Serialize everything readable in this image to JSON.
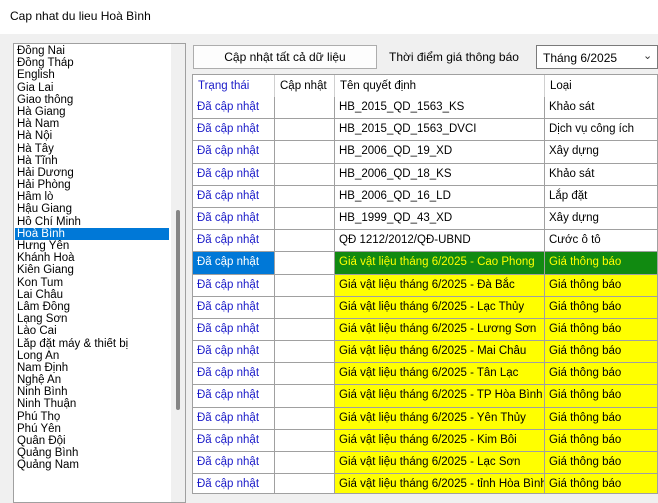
{
  "window": {
    "title": "Cap nhat du lieu Hoà Bình"
  },
  "provinces": {
    "items": [
      "Đồng Nai",
      "Đồng Tháp",
      "English",
      "Gia Lai",
      "Giao thông",
      "Hà Giang",
      "Hà Nam",
      "Hà Nội",
      "Hà Tây",
      "Hà Tĩnh",
      "Hải Dương",
      "Hải Phòng",
      "Hầm lò",
      "Hậu Giang",
      "Hồ Chí Minh",
      "Hoà Bình",
      "Hưng Yên",
      "Khánh Hoà",
      "Kiên Giang",
      "Kon Tum",
      "Lai Châu",
      "Lâm Đồng",
      "Lạng Sơn",
      "Lào Cai",
      "Lắp đặt máy & thiết bị",
      "Long An",
      "Nam Định",
      "Nghệ An",
      "Ninh Bình",
      "Ninh Thuận",
      "Phú Thọ",
      "Phú Yên",
      "Quân Đội",
      "Quảng Bình",
      "Quảng Nam"
    ],
    "selected": "Hoà Bình"
  },
  "toolbar": {
    "update_all_label": "Cập nhật tất cả dữ liệu",
    "time_label": "Thời điểm giá thông báo",
    "month_value": "Tháng 6/2025"
  },
  "grid": {
    "headers": [
      "Trạng thái",
      "Cập nhật",
      "Tên quyết định",
      "Loại"
    ],
    "rows": [
      {
        "status": "Đã cập nhật",
        "update": "",
        "name": "HB_2015_QD_1563_KS",
        "type": "Khảo sát",
        "highlight": "none"
      },
      {
        "status": "Đã cập nhật",
        "update": "",
        "name": "HB_2015_QD_1563_DVCI",
        "type": "Dịch vụ công ích",
        "highlight": "none"
      },
      {
        "status": "Đã cập nhật",
        "update": "",
        "name": "HB_2006_QD_19_XD",
        "type": "Xây dựng",
        "highlight": "none"
      },
      {
        "status": "Đã cập nhật",
        "update": "",
        "name": "HB_2006_QD_18_KS",
        "type": "Khảo sát",
        "highlight": "none"
      },
      {
        "status": "Đã cập nhật",
        "update": "",
        "name": "HB_2006_QD_16_LD",
        "type": "Lắp đặt",
        "highlight": "none"
      },
      {
        "status": "Đã cập nhật",
        "update": "",
        "name": "HB_1999_QD_43_XD",
        "type": "Xây dựng",
        "highlight": "none"
      },
      {
        "status": "Đã cập nhật",
        "update": "",
        "name": "QĐ 1212/2012/QĐ-UBND",
        "type": "Cước ô tô",
        "highlight": "none"
      },
      {
        "status": "Đã cập nhật",
        "update": "",
        "name": "Giá vật liệu tháng 6/2025 - Cao Phong",
        "type": "Giá thông báo",
        "highlight": "active"
      },
      {
        "status": "Đã cập nhật",
        "update": "",
        "name": "Giá vật liệu tháng 6/2025 - Đà Bắc",
        "type": "Giá thông báo",
        "highlight": "yellow"
      },
      {
        "status": "Đã cập nhật",
        "update": "",
        "name": "Giá vật liệu tháng 6/2025 - Lạc Thủy",
        "type": "Giá thông báo",
        "highlight": "yellow"
      },
      {
        "status": "Đã cập nhật",
        "update": "",
        "name": "Giá vật liệu tháng 6/2025 - Lương Sơn",
        "type": "Giá thông báo",
        "highlight": "yellow"
      },
      {
        "status": "Đã cập nhật",
        "update": "",
        "name": "Giá vật liệu tháng 6/2025 - Mai Châu",
        "type": "Giá thông báo",
        "highlight": "yellow"
      },
      {
        "status": "Đã cập nhật",
        "update": "",
        "name": "Giá vật liệu tháng 6/2025 - Tân Lạc",
        "type": "Giá thông báo",
        "highlight": "yellow"
      },
      {
        "status": "Đã cập nhật",
        "update": "",
        "name": "Giá vật liệu tháng 6/2025 - TP Hòa Bình",
        "type": "Giá thông báo",
        "highlight": "yellow"
      },
      {
        "status": "Đã cập nhật",
        "update": "",
        "name": "Giá vật liệu tháng 6/2025 - Yên Thủy",
        "type": "Giá thông báo",
        "highlight": "yellow"
      },
      {
        "status": "Đã cập nhật",
        "update": "",
        "name": "Giá vật liệu tháng 6/2025 - Kim Bôi",
        "type": "Giá thông báo",
        "highlight": "yellow"
      },
      {
        "status": "Đã cập nhật",
        "update": "",
        "name": "Giá vật liệu tháng 6/2025 - Lạc Sơn",
        "type": "Giá thông báo",
        "highlight": "yellow"
      },
      {
        "status": "Đã cập nhật",
        "update": "",
        "name": "Giá vật liệu tháng 6/2025 - tỉnh Hòa Bình",
        "type": "Giá thông báo",
        "highlight": "yellow"
      },
      {
        "status": "",
        "update": "",
        "name": "",
        "type": "",
        "highlight": "yellow"
      }
    ]
  },
  "colors": {
    "accent": "#0078d7",
    "highlight_yellow": "#ffff00",
    "active_green": "#118a11",
    "status_text": "#1a1ac8"
  }
}
